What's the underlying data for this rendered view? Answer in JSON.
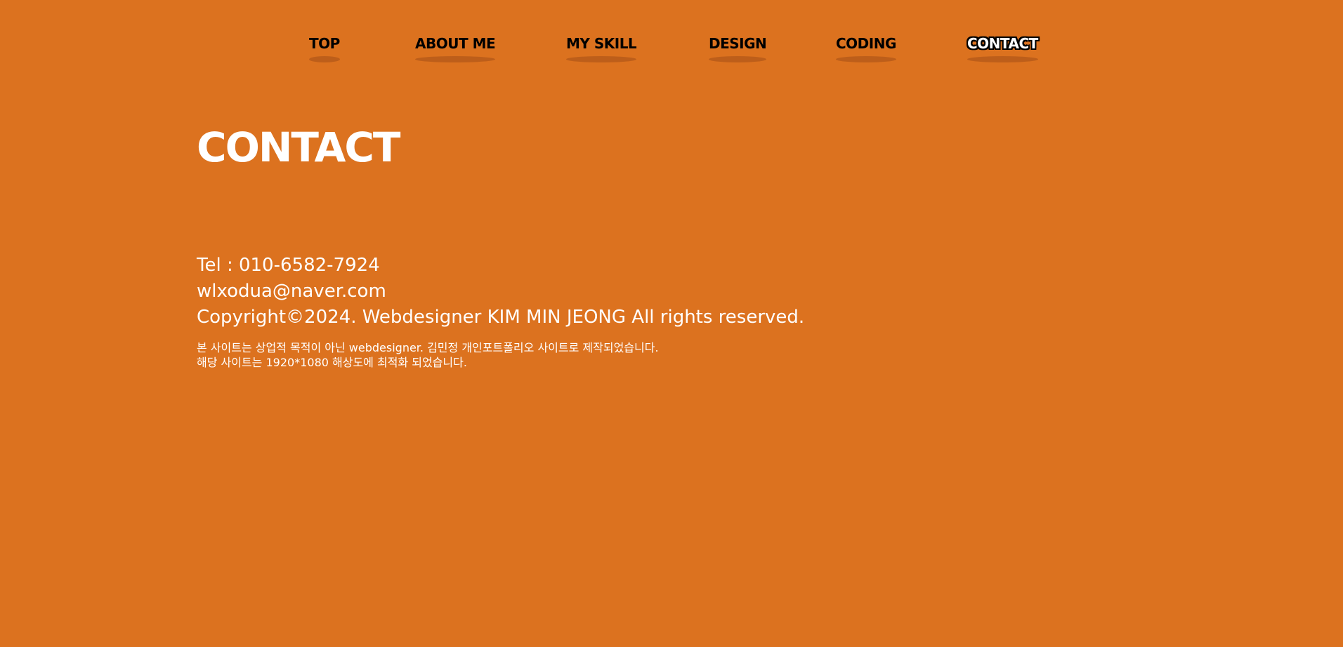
{
  "theme": {
    "background": "#DC721F",
    "text": "#FFFFFF",
    "nav_text": "#000000"
  },
  "nav": {
    "items": [
      {
        "label": "TOP",
        "active": false
      },
      {
        "label": "ABOUT ME",
        "active": false
      },
      {
        "label": "MY SKILL",
        "active": false
      },
      {
        "label": "DESIGN",
        "active": false
      },
      {
        "label": "CODING",
        "active": false
      },
      {
        "label": "CONTACT",
        "active": true
      }
    ]
  },
  "section": {
    "title": "CONTACT"
  },
  "contact": {
    "tel": "Tel : 010-6582-7924",
    "email": "wlxodua@naver.com",
    "copyright": "Copyright©2024. Webdesigner KIM MIN JEONG All rights reserved."
  },
  "notice": {
    "line1": "본 사이트는 상업적 목적이 아닌 webdesigner. 김민정 개인포트폴리오 사이트로 제작되었습니다.",
    "line2": "해당 사이트는 1920*1080 해상도에 최적화 되었습니다."
  }
}
